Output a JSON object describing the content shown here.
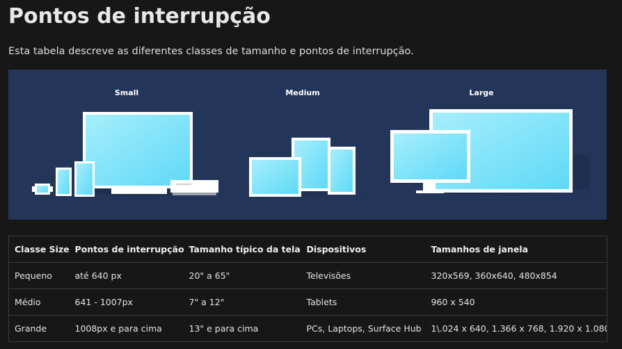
{
  "page": {
    "title": "Pontos de interrupção",
    "description": "Esta tabela descreve as diferentes classes de tamanho e pontos de interrupção."
  },
  "illustration": {
    "background": "#23365a",
    "screen_color": "#8fe6fb",
    "labels": [
      "Small",
      "Medium",
      "Large"
    ]
  },
  "table": {
    "headers": [
      "Classe Size",
      "Pontos de interrupção",
      "Tamanho típico da tela",
      "Dispositivos",
      "Tamanhos de janela"
    ],
    "rows": [
      [
        "Pequeno",
        "até 640 px",
        "20\" a 65\"",
        "Televisões",
        "320x569, 360x640, 480x854"
      ],
      [
        "Médio",
        "641 - 1007px",
        "7\" a 12\"",
        "Tablets",
        "960 x 540"
      ],
      [
        "Grande",
        "1008px e para cima",
        "13\" e para cima",
        "PCs, Laptops, Surface Hub",
        "1\\.024 x 640, 1.366 x 768, 1.920 x 1.080"
      ]
    ]
  }
}
